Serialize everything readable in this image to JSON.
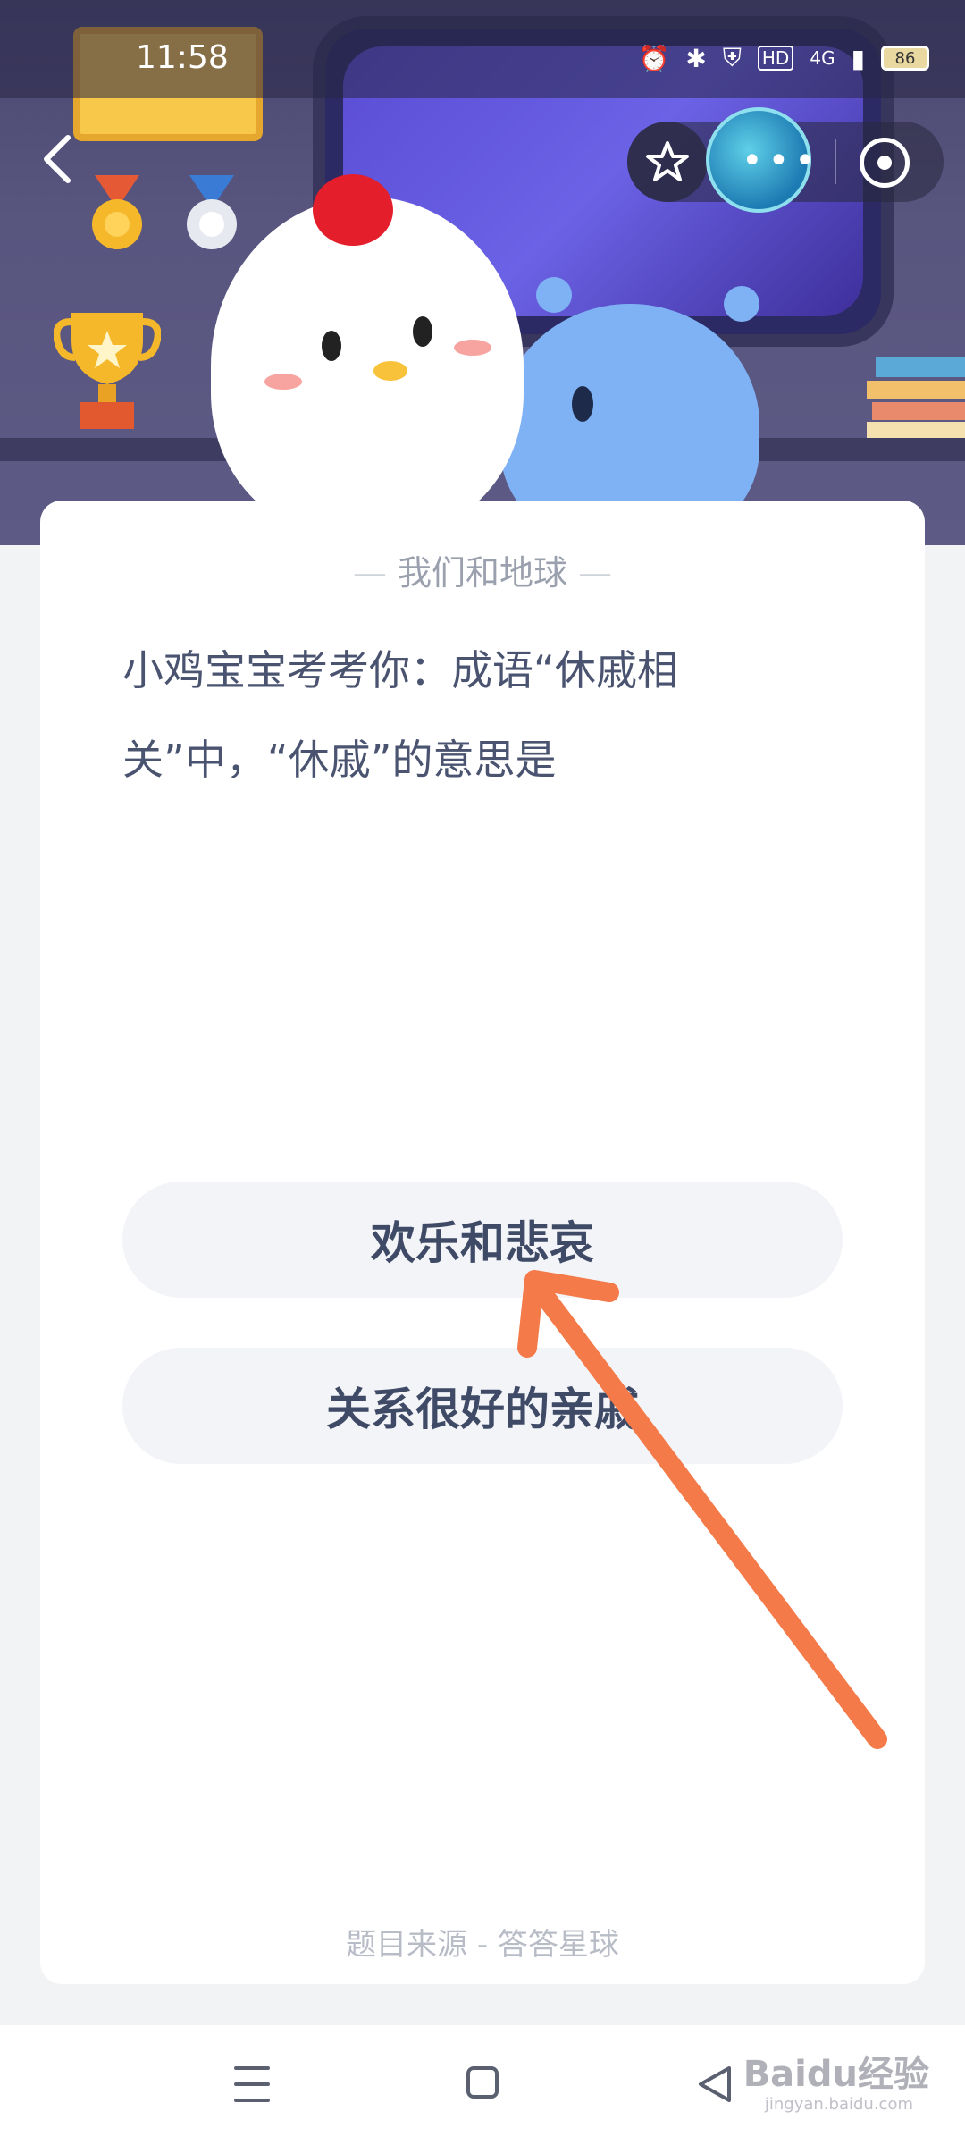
{
  "status_bar": {
    "time": "11:58",
    "network": "4G",
    "battery": "86",
    "icons": [
      "alarm-icon",
      "bluetooth-icon",
      "shield-icon",
      "hd-icon",
      "signal-icon",
      "battery-icon"
    ]
  },
  "header": {
    "back_icon": "chevron-left-icon",
    "capsule": {
      "favorite_icon": "star-icon",
      "more_icon": "more-dots-icon",
      "close_icon": "target-icon"
    }
  },
  "card": {
    "category": "我们和地球",
    "question": "小鸡宝宝考考你：成语“休戚相关”中，“休戚”的意思是",
    "options": [
      {
        "label": "欢乐和悲哀"
      },
      {
        "label": "关系很好的亲戚"
      }
    ],
    "source": "题目来源 - 答答星球"
  },
  "watermark": {
    "brand": "Baidu经验",
    "url": "jingyan.baidu.com"
  },
  "colors": {
    "arrow": "#f47a4a",
    "text_primary": "#4a5470",
    "option_bg": "#f3f4f7"
  }
}
